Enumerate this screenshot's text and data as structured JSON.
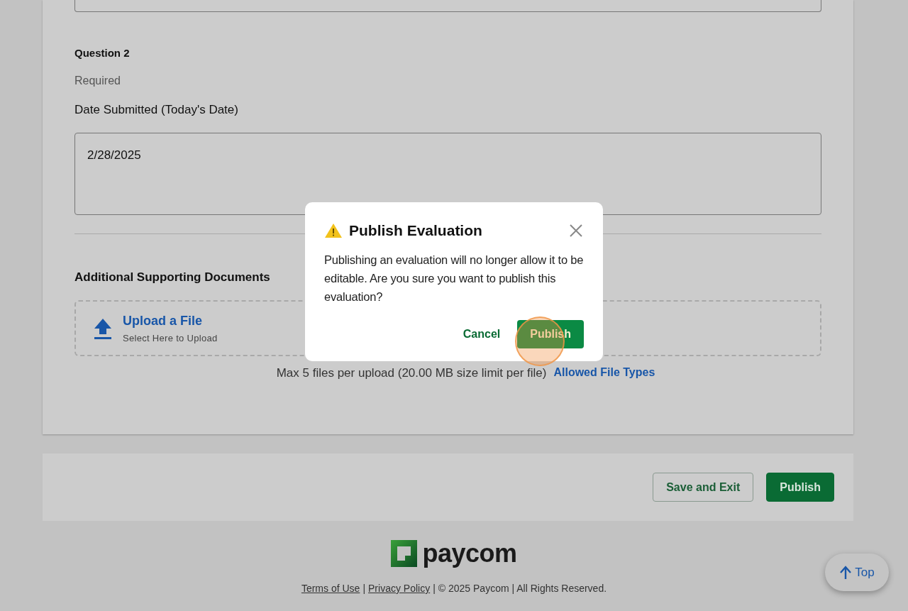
{
  "question": {
    "title": "Question 2",
    "note": "Required",
    "label": "Date Submitted (Today's Date)",
    "value": "2/28/2025"
  },
  "attachments": {
    "title": "Additional Supporting Documents",
    "upload_title": "Upload a File",
    "upload_hint": "Select Here to Upload",
    "limit_text": "Max 5 files per upload (20.00 MB size limit per file)",
    "link": "Allowed File Types"
  },
  "actions": [
    "Save and Exit",
    "Publish"
  ],
  "footer": {
    "logo": "paycom",
    "links": [
      "Terms of Use",
      "Privacy Policy"
    ],
    "separator": "|",
    "copyright": "© 2025 Paycom | All Rights Reserved."
  },
  "top_button": "Top",
  "dialog": {
    "title": "Publish Evaluation",
    "message": "Publishing an evaluation will no longer allow it to be editable. Are you sure you want to publish this evaluation?",
    "cancel": "Cancel",
    "confirm": "Publish"
  }
}
